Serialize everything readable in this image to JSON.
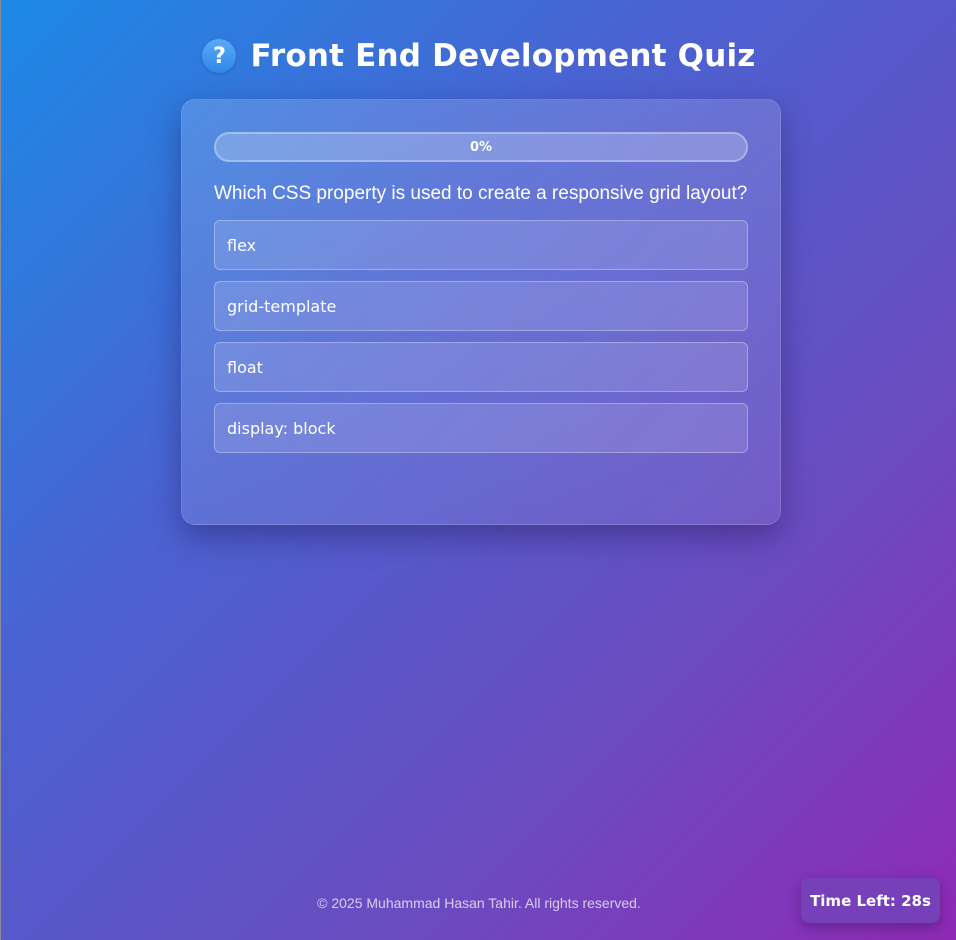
{
  "header": {
    "icon": "help-icon",
    "icon_glyph": "?",
    "title": "Front End Development Quiz"
  },
  "quiz": {
    "progress": {
      "percent": 0,
      "label": "0%"
    },
    "question": "Which CSS property is used to create a responsive grid layout?",
    "options": [
      {
        "label": "flex"
      },
      {
        "label": "grid-template"
      },
      {
        "label": "float"
      },
      {
        "label": "display: block"
      }
    ]
  },
  "footer": {
    "copyright": "© 2025 Muhammad Hasan Tahir. All rights reserved."
  },
  "timer": {
    "label": "Time Left: 28s"
  },
  "colors": {
    "gradient_start": "#1c8ae6",
    "gradient_end": "#8f2ab5",
    "timer_bg": "#7640b8",
    "icon_bg": "#2f86e8"
  }
}
